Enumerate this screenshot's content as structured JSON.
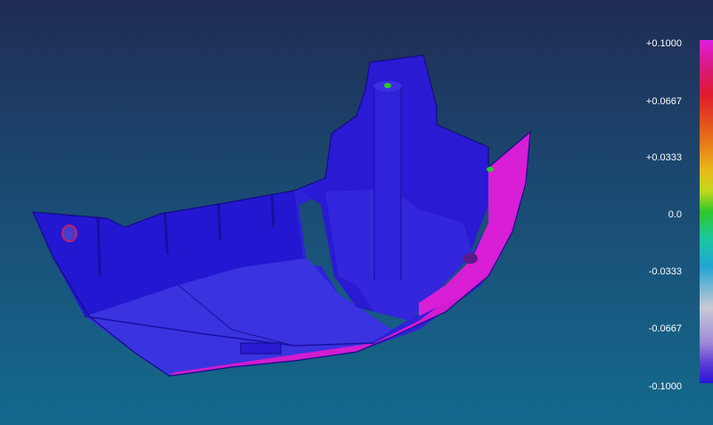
{
  "colorbar": {
    "ticks": [
      "+0.1000",
      "+0.0667",
      "+0.0333",
      "0.0",
      "-0.0333",
      "-0.0667",
      "-0.1000"
    ],
    "top_color": "#e01ee0",
    "mid_color": "#2ec82a",
    "bottom_color": "#2a14d8"
  },
  "model": {
    "base_color": "#2a14d8",
    "highlight_color": "#e01ee0",
    "marker_color": "#2ec82a",
    "background_top": "#1f2c53",
    "background_bottom": "#146a8e"
  }
}
